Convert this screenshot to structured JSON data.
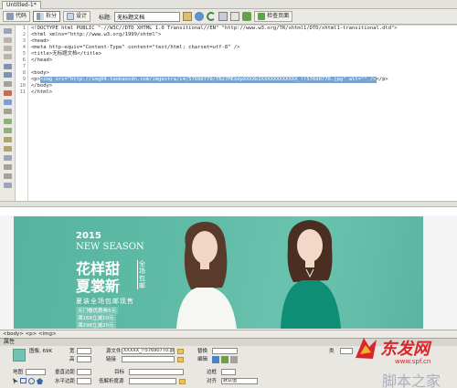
{
  "document_tab": {
    "title": "Untitled-1*"
  },
  "toolbar": {
    "code_label": "代码",
    "split_label": "拆分",
    "design_label": "设计",
    "title_label": "标题:",
    "title_value": "无标题文档",
    "check_page_label": "检查页面"
  },
  "code_view": {
    "line_numbers": [
      "1",
      "2",
      "3",
      "4",
      "5",
      "6",
      "7",
      "8",
      "9",
      "10",
      "11"
    ],
    "lines": [
      "<!DOCTYPE html PUBLIC \"-//W3C//DTD XHTML 1.0 Transitional//EN\" \"http://www.w3.org/TR/xhtml1/DTD/xhtml1-transitional.dtd\">",
      "<html xmlns=\"http://www.w3.org/1999/xhtml\">",
      "<head>",
      "<meta http-equiv=\"Content-Type\" content=\"text/html; charset=utf-8\" />",
      "<title>无标题文档</title>",
      "</head>",
      "",
      "<body>",
      "",
      "</body>",
      "</html>"
    ],
    "selected_line_prefix": "<p>",
    "selected_text": "<img src=\"http://img04.taobaocdn.com/imgextra/i4/57690770/TB27MEXdpXXXXbIXXXXXXXXXXXX_!!57690770.jpg\" alt=\"\" />",
    "selected_line_suffix": "</p>"
  },
  "banner": {
    "year": "2015",
    "season": "NEW SEASON",
    "headline_line1": "花样甜",
    "headline_line2": "夏裳新",
    "badge": "全场包邮",
    "subtitle": "夏装全场包邮现售",
    "promo1": "天门楼优惠券5元",
    "promo2": "满168立减10元",
    "promo3": "满298立减20元"
  },
  "status_bar": {
    "breadcrumb": "<body> <p> <img>"
  },
  "properties_panel": {
    "header": "属性",
    "image_label": "图像, 69K",
    "width_label": "宽",
    "height_label": "高",
    "src_label": "源文件",
    "src_value": "XXXXX_!!57690770.jpg",
    "alt_label": "替换",
    "link_label": "链接",
    "edit_label": "编辑",
    "class_label": "类",
    "map_label": "地图",
    "vspace_label": "垂直边距",
    "target_label": "目标",
    "hspace_label": "水平边距",
    "lowsrc_label": "低解析度源",
    "border_label": "边框",
    "align_label": "对齐",
    "align_value": "默认值"
  },
  "watermark": {
    "brand": "东发网",
    "site": "www.spf.cn",
    "tagline": "脚本之家"
  },
  "colors": {
    "banner_bg": "#5fbba6",
    "selection": "#7aa3cf",
    "brand_red": "#d7262c"
  }
}
